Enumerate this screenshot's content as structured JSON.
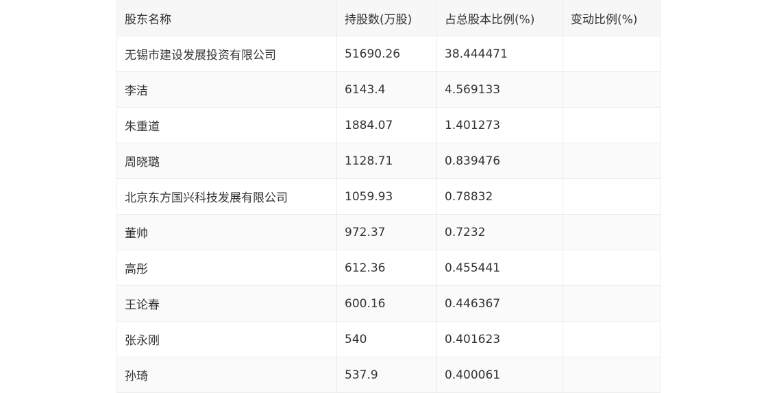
{
  "table": {
    "headers": [
      "股东名称",
      "持股数(万股)",
      "占总股本比例(%)",
      "变动比例(%)"
    ],
    "rows": [
      [
        "无锡市建设发展投资有限公司",
        "51690.26",
        "38.444471",
        ""
      ],
      [
        "李洁",
        "6143.4",
        "4.569133",
        ""
      ],
      [
        "朱重道",
        "1884.07",
        "1.401273",
        ""
      ],
      [
        "周晓璐",
        "1128.71",
        "0.839476",
        ""
      ],
      [
        "北京东方国兴科技发展有限公司",
        "1059.93",
        "0.78832",
        ""
      ],
      [
        "董帅",
        "972.37",
        "0.7232",
        ""
      ],
      [
        "高彤",
        "612.36",
        "0.455441",
        ""
      ],
      [
        "王论春",
        "600.16",
        "0.446367",
        ""
      ],
      [
        "张永刚",
        "540",
        "0.401623",
        ""
      ],
      [
        "孙琦",
        "537.9",
        "0.400061",
        ""
      ]
    ]
  }
}
